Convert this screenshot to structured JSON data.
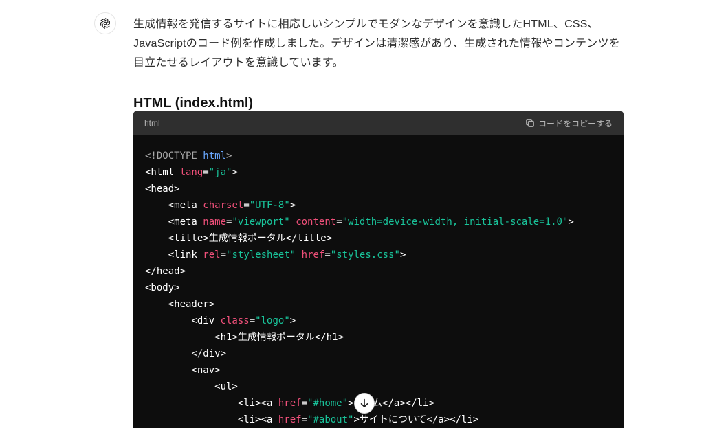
{
  "message": {
    "paragraph": "生成情報を発信するサイトに相応しいシンプルでモダンなデザインを意識したHTML、CSS、JavaScriptのコード例を作成しました。デザインは清潔感があり、生成された情報やコンテンツを目立たせるレイアウトを意識しています。",
    "heading": "HTML (index.html)"
  },
  "code": {
    "language": "html",
    "copy_label": "コードをコピーする",
    "lines": [
      [
        [
          "doctype",
          "<!DOCTYPE "
        ],
        [
          "kw",
          "html"
        ],
        [
          "doctype",
          ">"
        ]
      ],
      [
        [
          "punct",
          "<html "
        ],
        [
          "attr",
          "lang"
        ],
        [
          "punct",
          "="
        ],
        [
          "str",
          "\"ja\""
        ],
        [
          "punct",
          ">"
        ]
      ],
      [
        [
          "punct",
          "<head>"
        ]
      ],
      [
        [
          "punct",
          "    <meta "
        ],
        [
          "attr",
          "charset"
        ],
        [
          "punct",
          "="
        ],
        [
          "str",
          "\"UTF-8\""
        ],
        [
          "punct",
          ">"
        ]
      ],
      [
        [
          "punct",
          "    <meta "
        ],
        [
          "attr",
          "name"
        ],
        [
          "punct",
          "="
        ],
        [
          "str",
          "\"viewport\""
        ],
        [
          "punct",
          " "
        ],
        [
          "attr",
          "content"
        ],
        [
          "punct",
          "="
        ],
        [
          "str",
          "\"width=device-width, initial-scale=1.0\""
        ],
        [
          "punct",
          ">"
        ]
      ],
      [
        [
          "punct",
          "    <title>生成情報ポータル</title>"
        ]
      ],
      [
        [
          "punct",
          "    <link "
        ],
        [
          "attr",
          "rel"
        ],
        [
          "punct",
          "="
        ],
        [
          "str",
          "\"stylesheet\""
        ],
        [
          "punct",
          " "
        ],
        [
          "attr",
          "href"
        ],
        [
          "punct",
          "="
        ],
        [
          "str",
          "\"styles.css\""
        ],
        [
          "punct",
          ">"
        ]
      ],
      [
        [
          "punct",
          "</head>"
        ]
      ],
      [
        [
          "punct",
          "<body>"
        ]
      ],
      [
        [
          "punct",
          "    <header>"
        ]
      ],
      [
        [
          "punct",
          "        <div "
        ],
        [
          "attr",
          "class"
        ],
        [
          "punct",
          "="
        ],
        [
          "str",
          "\"logo\""
        ],
        [
          "punct",
          ">"
        ]
      ],
      [
        [
          "punct",
          "            <h1>生成情報ポータル</h1>"
        ]
      ],
      [
        [
          "punct",
          "        </div>"
        ]
      ],
      [
        [
          "punct",
          "        <nav>"
        ]
      ],
      [
        [
          "punct",
          "            <ul>"
        ]
      ],
      [
        [
          "punct",
          "                <li><a "
        ],
        [
          "attr",
          "href"
        ],
        [
          "punct",
          "="
        ],
        [
          "str",
          "\"#home\""
        ],
        [
          "punct",
          ">ホーム</a></li>"
        ]
      ],
      [
        [
          "punct",
          "                <li><a "
        ],
        [
          "attr",
          "href"
        ],
        [
          "punct",
          "="
        ],
        [
          "str",
          "\"#about\""
        ],
        [
          "punct",
          ">サイトについて</a></li>"
        ]
      ]
    ]
  },
  "icons": {
    "avatar": "openai-logo-icon",
    "copy": "copy-icon",
    "scroll": "arrow-down-icon"
  },
  "colors": {
    "code_background": "#0d0d0d",
    "code_header": "#2f2f2f",
    "attribute": "#f0507a",
    "string": "#19c39a",
    "keyword": "#6aa8ff"
  }
}
